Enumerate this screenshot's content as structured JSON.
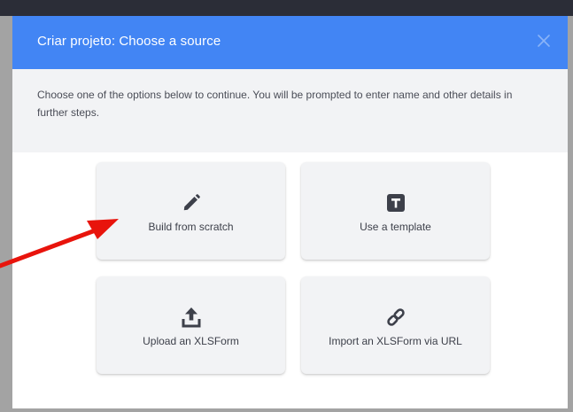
{
  "modal": {
    "title": "Criar projeto: Choose a source",
    "description": "Choose one of the options below to continue. You will be prompted to enter name and other details in further steps."
  },
  "options": [
    {
      "label": "Build from scratch",
      "icon": "pencil-icon"
    },
    {
      "label": "Use a template",
      "icon": "template-icon"
    },
    {
      "label": "Upload an XLSForm",
      "icon": "upload-icon"
    },
    {
      "label": "Import an XLSForm via URL",
      "icon": "link-icon"
    }
  ],
  "colors": {
    "header": "#4285f4",
    "info_bar": "#f2f3f5",
    "card": "#f2f3f5",
    "icon": "#3d404a",
    "annotation_arrow": "#e8140c"
  }
}
